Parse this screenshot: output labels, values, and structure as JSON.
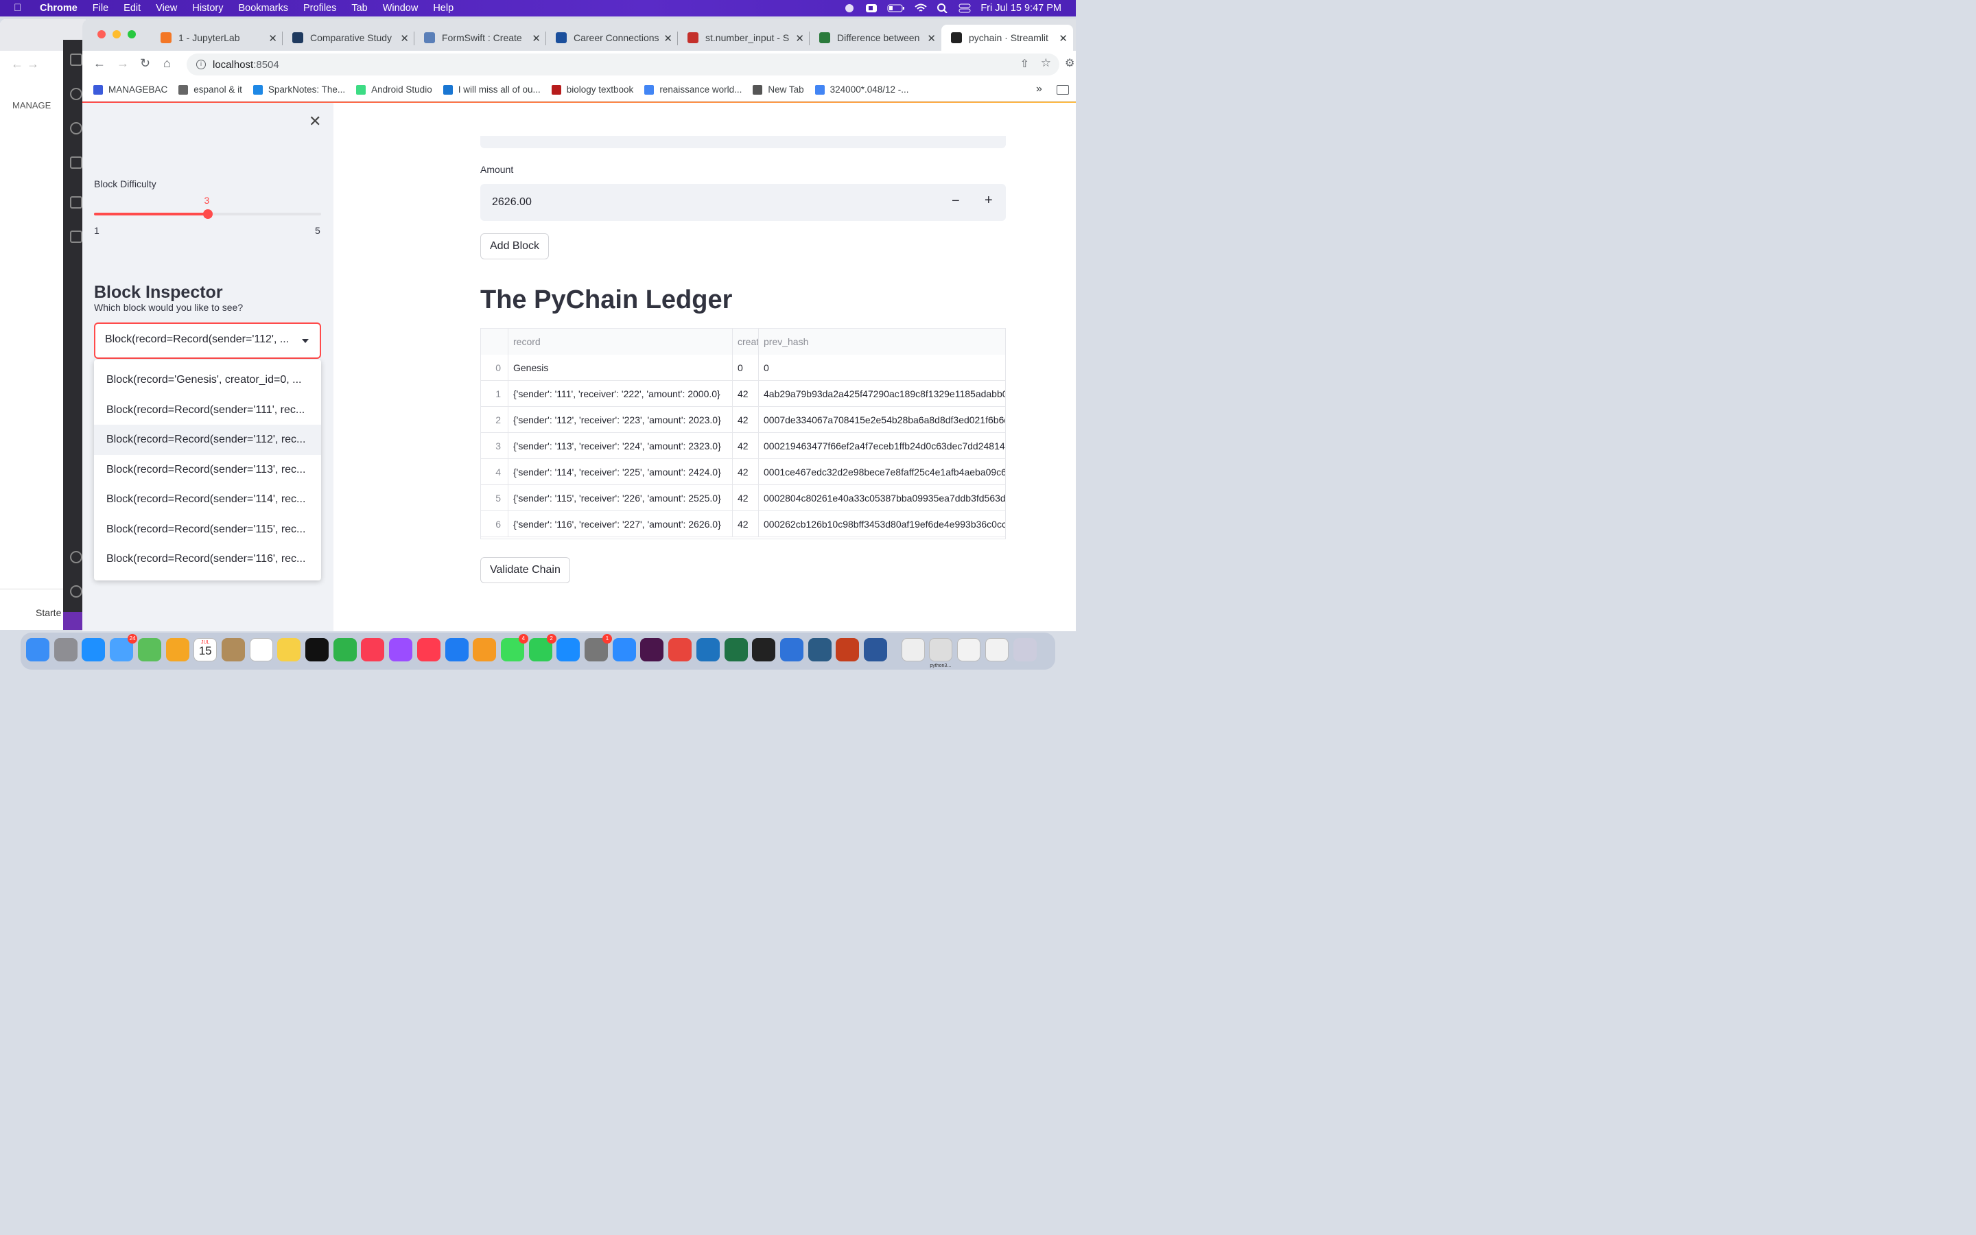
{
  "menubar": {
    "app": "Chrome",
    "items": [
      "File",
      "Edit",
      "View",
      "History",
      "Bookmarks",
      "Profiles",
      "Tab",
      "Window",
      "Help"
    ],
    "clock": "Fri Jul 15  9:47 PM"
  },
  "background_window": {
    "bookmark": "MANAGE",
    "status_item": "Starte"
  },
  "tabs": [
    {
      "title": "1 - JupyterLab",
      "color": "#f37726"
    },
    {
      "title": "Comparative Study",
      "color": "#1f3a5f"
    },
    {
      "title": "FormSwift : Create",
      "color": "#5a7fb8"
    },
    {
      "title": "Career Connections",
      "color": "#1b4f9c"
    },
    {
      "title": "st.number_input - S",
      "color": "#c4302b"
    },
    {
      "title": "Difference between",
      "color": "#2a7a3b"
    },
    {
      "title": "pychain · Streamlit",
      "color": "#222"
    }
  ],
  "url": {
    "host": "localhost",
    "port": ":8504"
  },
  "bookmarks": [
    {
      "label": "MANAGEBAC",
      "color": "#3b5bdb"
    },
    {
      "label": "espanol & it",
      "color": "#666"
    },
    {
      "label": "SparkNotes: The...",
      "color": "#1e88e5"
    },
    {
      "label": "Android Studio",
      "color": "#3ddc84"
    },
    {
      "label": "I will miss all of ou...",
      "color": "#1976d2"
    },
    {
      "label": "biology textbook",
      "color": "#b71c1c"
    },
    {
      "label": "renaissance world...",
      "color": "#4285f4"
    },
    {
      "label": "New Tab",
      "color": "#555"
    },
    {
      "label": "324000*.048/12 -...",
      "color": "#4285f4"
    }
  ],
  "sidebar": {
    "difficulty_label": "Block Difficulty",
    "difficulty_value": "3",
    "difficulty_min": "1",
    "difficulty_max": "5",
    "difficulty_fraction": 0.5,
    "inspector_title": "Block Inspector",
    "question": "Which block would you like to see?",
    "selected": "Block(record=Record(sender='112', ...",
    "options": [
      "Block(record='Genesis', creator_id=0, ...",
      "Block(record=Record(sender='111', rec...",
      "Block(record=Record(sender='112', rec...",
      "Block(record=Record(sender='113', rec...",
      "Block(record=Record(sender='114', rec...",
      "Block(record=Record(sender='115', rec...",
      "Block(record=Record(sender='116', rec..."
    ],
    "highlighted_index": 2
  },
  "main": {
    "amount_label": "Amount",
    "amount_value": "2626.00",
    "minus": "−",
    "plus": "+",
    "add_block": "Add Block",
    "ledger_title": "The PyChain Ledger",
    "validate": "Validate Chain",
    "table": {
      "headers": [
        "",
        "record",
        "creat",
        "prev_hash"
      ],
      "rows": [
        [
          "0",
          "Genesis",
          "0",
          "0"
        ],
        [
          "1",
          "{'sender': '111', 'receiver': '222', 'amount': 2000.0}",
          "42",
          "4ab29a79b93da2a425f47290ac189c8f1329e1185adabb0"
        ],
        [
          "2",
          "{'sender': '112', 'receiver': '223', 'amount': 2023.0}",
          "42",
          "0007de334067a708415e2e54b28ba6a8d8df3ed021f6b6d"
        ],
        [
          "3",
          "{'sender': '113', 'receiver': '224', 'amount': 2323.0}",
          "42",
          "000219463477f66ef2a4f7eceb1ffb24d0c63dec7dd24814"
        ],
        [
          "4",
          "{'sender': '114', 'receiver': '225', 'amount': 2424.0}",
          "42",
          "0001ce467edc32d2e98bece7e8faff25c4e1afb4aeba09c6"
        ],
        [
          "5",
          "{'sender': '115', 'receiver': '226', 'amount': 2525.0}",
          "42",
          "0002804c80261e40a33c05387bba09935ea7ddb3fd563d"
        ],
        [
          "6",
          "{'sender': '116', 'receiver': '227', 'amount': 2626.0}",
          "42",
          "000262cb126b10c98bff3453d80af19ef6de4e993b36c0cc"
        ]
      ]
    }
  },
  "dock": {
    "calendar_month": "JUL",
    "calendar_day": "15",
    "badges": {
      "mail": "24",
      "messages": "4",
      "facetime": "2",
      "settings": "1"
    },
    "thumbnail_label": "python3..."
  }
}
